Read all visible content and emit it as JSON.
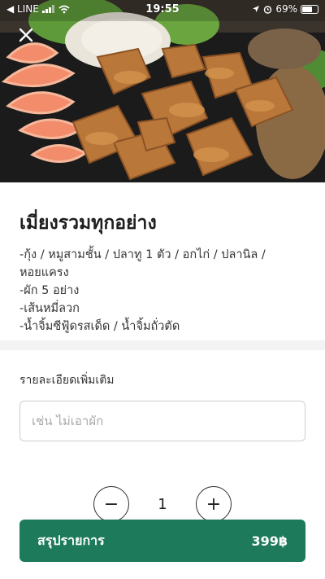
{
  "status_bar": {
    "carrier": "◀ LINE",
    "time": "19:55",
    "battery_percent": "69%",
    "battery_level": 0.69
  },
  "item": {
    "title": "เมี่ยงรวมทุกอย่าง",
    "description_lines": [
      "-กุ้ง / หมูสามชั้น / ปลาทู 1 ตัว / อกไก่ / ปลานิล /",
      "หอยแครง",
      "-ผัก 5 อย่าง",
      "-เส้นหมี่ลวก",
      "-น้ำจิ้มซีฟู้ดรสเด็ด / น้ำจิ้มถั่วตัด"
    ]
  },
  "details": {
    "label": "รายละเอียดเพิ่มเติม",
    "placeholder": "เช่น ไม่เอาผัก",
    "value": ""
  },
  "quantity": {
    "value": "1",
    "minus": "−",
    "plus": "+"
  },
  "summary": {
    "label": "สรุปรายการ",
    "price": "399฿",
    "color": "#1d7a5a"
  },
  "icons": {
    "close": "close-icon",
    "signal": "signal-icon",
    "wifi": "wifi-icon",
    "location": "location-icon",
    "alarm": "alarm-icon",
    "battery": "battery-icon"
  }
}
